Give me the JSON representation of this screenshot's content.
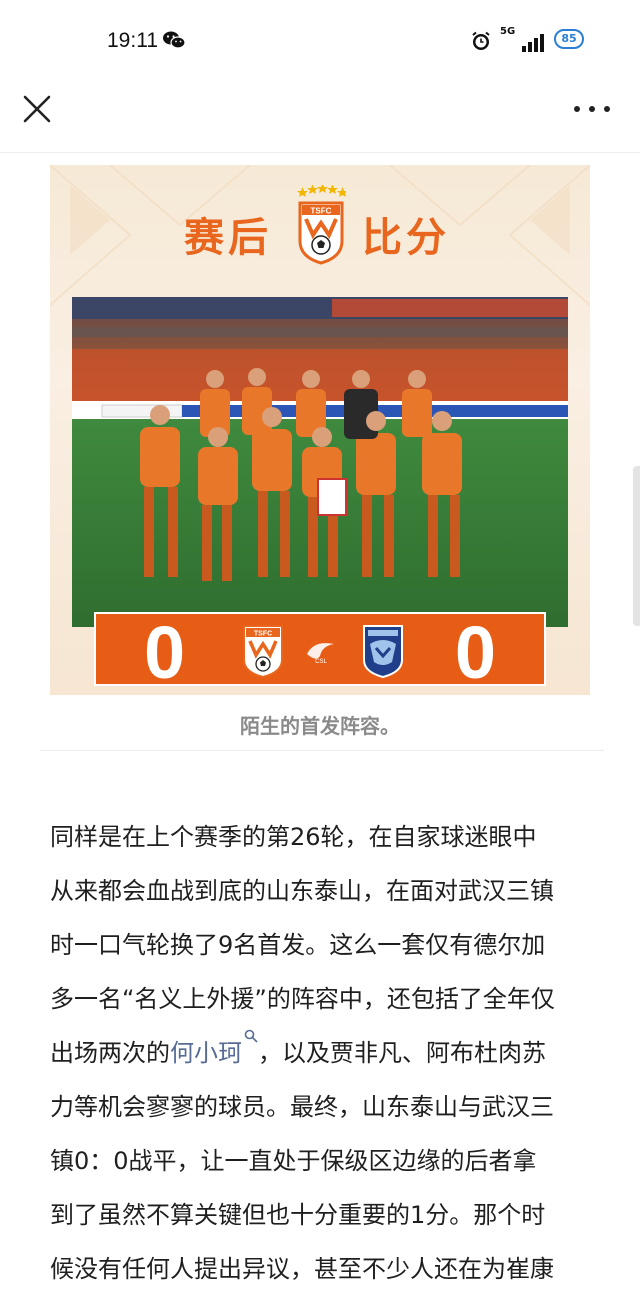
{
  "status_bar": {
    "time": "19:11",
    "network": "5G",
    "battery": "85"
  },
  "nav": {
    "close_icon": "close-icon",
    "more_icon": "more-icon"
  },
  "poster": {
    "title_left": "赛后",
    "title_right": "比分",
    "home_score": "0",
    "away_score": "0",
    "crest_text": "TSFC",
    "colors": {
      "orange": "#e85d16",
      "cream": "#f6e9d6"
    }
  },
  "caption": "陌生的首发阵容。",
  "article": {
    "lines": [
      "同样是在上个赛季的第26轮，在自家球迷眼中",
      "从来都会血战到底的山东泰山，在面对武汉三镇",
      "时一口气轮换了9名首发。这么一套仅有德尔加",
      "多一名“名义上外援”的阵容中，还包括了全年仅",
      "出场两次的",
      "何小珂",
      "，以及贾非凡、阿布杜肉苏",
      "力等机会寥寥的球员。最终，山东泰山与武汉三",
      "镇0：0战平，让一直处于保级区边缘的后者拿",
      "到了虽然不算关键但也十分重要的1分。那个时",
      "候没有任何人提出异议，甚至不少人还在为崔康"
    ]
  }
}
